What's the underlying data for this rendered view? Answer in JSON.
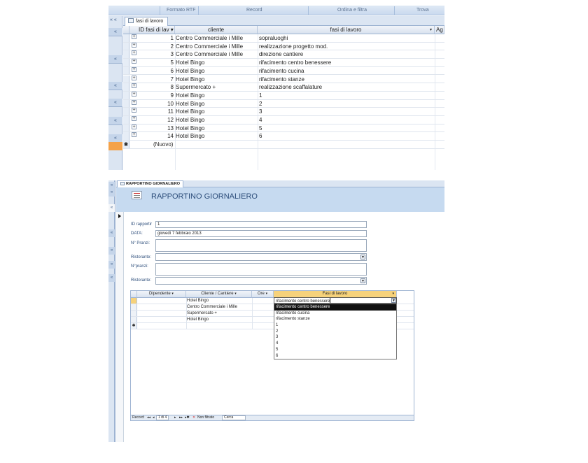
{
  "ribbon": {
    "groups": [
      "Formato RTF",
      "Record",
      "Ordina e filtra",
      "Trova"
    ]
  },
  "table_view": {
    "nav_top_label": "« «",
    "tab_title": "fasi di lavoro",
    "columns": [
      "ID fasi di lav ▾",
      "cliente",
      "fasi di lavoro",
      "Ag"
    ],
    "rows": [
      {
        "id": "1",
        "cliente": "Centro Commerciale i Mille",
        "fase": "sopraluoghi"
      },
      {
        "id": "2",
        "cliente": "Centro Commerciale i Mille",
        "fase": "realizzazione progetto mod."
      },
      {
        "id": "3",
        "cliente": "Centro Commerciale i Mille",
        "fase": "direzione cantiere"
      },
      {
        "id": "5",
        "cliente": "Hotel Bingo",
        "fase": "rifacimento centro benessere"
      },
      {
        "id": "6",
        "cliente": "Hotel Bingo",
        "fase": "rifacimento cucina"
      },
      {
        "id": "7",
        "cliente": "Hotel Bingo",
        "fase": "rifacimento stanze"
      },
      {
        "id": "8",
        "cliente": "Supermercato +",
        "fase": "realizzazione scaffalature"
      },
      {
        "id": "9",
        "cliente": "Hotel Bingo",
        "fase": "1"
      },
      {
        "id": "10",
        "cliente": "Hotel Bingo",
        "fase": "2"
      },
      {
        "id": "11",
        "cliente": "Hotel Bingo",
        "fase": "3"
      },
      {
        "id": "12",
        "cliente": "Hotel Bingo",
        "fase": "4"
      },
      {
        "id": "13",
        "cliente": "Hotel Bingo",
        "fase": "5"
      },
      {
        "id": "14",
        "cliente": "Hotel Bingo",
        "fase": "6"
      }
    ],
    "new_row_marker": "✱",
    "new_row_label": "(Nuovo)"
  },
  "form_view": {
    "tab_title": "RAPPORTINO GIORNALIERO",
    "header_title": "RAPPORTINO GIORNALIERO",
    "fields": [
      {
        "label": "ID rapportir",
        "value": ""
      },
      {
        "label": "DATA:",
        "value": "giovedì 7 febbraio 2013"
      },
      {
        "label": "N° Pranzi:",
        "value": ""
      },
      {
        "label": "Ristorante:",
        "value": ""
      },
      {
        "label": "N°pranzi:",
        "value": ""
      },
      {
        "label": "Ristorante:",
        "value": ""
      }
    ],
    "id_value": "1",
    "subform": {
      "columns": [
        "Dipendente",
        "Cliente / Cantiere",
        "Ore",
        "Fasi di lavoro"
      ],
      "rows": [
        {
          "dipendente": "",
          "cliente": "Hotel Bingo",
          "ore": "",
          "fase": "rifacimento centro benessere"
        },
        {
          "dipendente": "",
          "cliente": "Centro Commerciale i Mille",
          "ore": "",
          "fase": ""
        },
        {
          "dipendente": "",
          "cliente": "Supermercato +",
          "ore": "",
          "fase": ""
        },
        {
          "dipendente": "",
          "cliente": "Hotel Bingo",
          "ore": "",
          "fase": ""
        }
      ],
      "new_row_marker": "✱",
      "dropdown_options": [
        "rifacimento centro benessere",
        "rifacimento cucina",
        "rifacimento stanze",
        "1",
        "2",
        "3",
        "4",
        "5",
        "6"
      ],
      "dropdown_selected_index": 0
    },
    "record_nav": {
      "label": "Record:",
      "first": "◂◂",
      "prev": "◂",
      "position": "1 di 4",
      "next": "▸",
      "last": "▸▸",
      "new": "▸✱",
      "filter": "Non filtrato",
      "search": "Cerca"
    }
  }
}
